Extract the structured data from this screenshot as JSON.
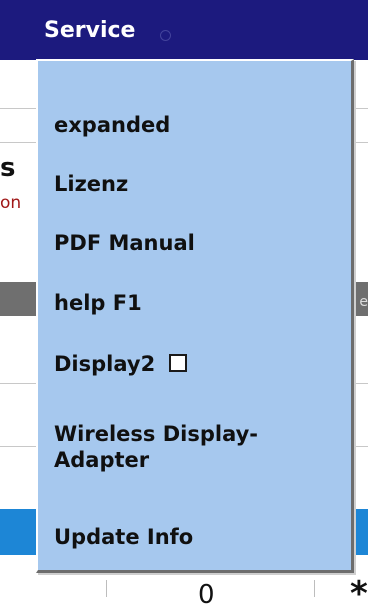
{
  "menu_bar": {
    "title": "Service"
  },
  "background": {
    "fragment_s": "s",
    "fragment_on": "on",
    "fragment_edge": "e",
    "bottom_value": "0",
    "bottom_star": "*"
  },
  "dropdown": {
    "items": [
      {
        "label": "expanded"
      },
      {
        "label": "Lizenz"
      },
      {
        "label": "PDF Manual"
      },
      {
        "label": "help F1"
      },
      {
        "label": "Display2",
        "checkbox_checked": false
      },
      {
        "label": "Wireless Display-Adapter"
      },
      {
        "label": "Update Info"
      }
    ]
  },
  "colors": {
    "menubar": "#1c1a7e",
    "dropdown_bg": "#a6c8ee",
    "accent_blue": "#1d86d6",
    "band_gray": "#6f6f6f",
    "text_red": "#a01818"
  }
}
